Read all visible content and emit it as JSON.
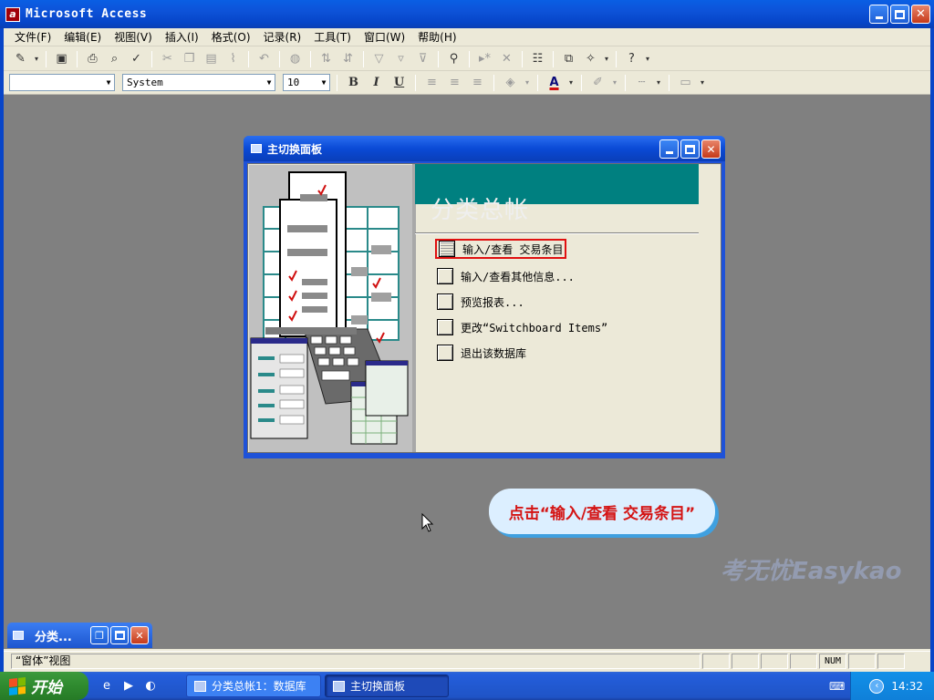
{
  "app": {
    "title": "Microsoft Access",
    "icon_letter": "a"
  },
  "menu": [
    "文件(F)",
    "编辑(E)",
    "视图(V)",
    "插入(I)",
    "格式(O)",
    "记录(R)",
    "工具(T)",
    "窗口(W)",
    "帮助(H)"
  ],
  "toolbar": {
    "font_name": "System",
    "font_size": "10",
    "object_combo": "",
    "bold": "B",
    "italic": "I",
    "underline": "U",
    "font_color_glyph": "A"
  },
  "switchboard": {
    "window_title": "主切换面板",
    "header": "分类总帐",
    "items": [
      {
        "label": "输入/查看 交易条目",
        "highlighted": true
      },
      {
        "label": "输入/查看其他信息...",
        "highlighted": false
      },
      {
        "label": "预览报表...",
        "highlighted": false
      },
      {
        "label": "更改“Switchboard Items”",
        "highlighted": false
      },
      {
        "label": "退出该数据库",
        "highlighted": false
      }
    ],
    "header_color": "#008080"
  },
  "callout": {
    "text": "点击“输入/查看 交易条目”",
    "text_color": "#d41414"
  },
  "watermark": "考无忧Easykao",
  "minimized_window": {
    "label": "分类..."
  },
  "status": {
    "text": "“窗体”视图",
    "num": "NUM"
  },
  "taskbar": {
    "start": "开始",
    "tasks": [
      "分类总帐1：数据库",
      "主切换面板"
    ],
    "clock": "14:32"
  }
}
